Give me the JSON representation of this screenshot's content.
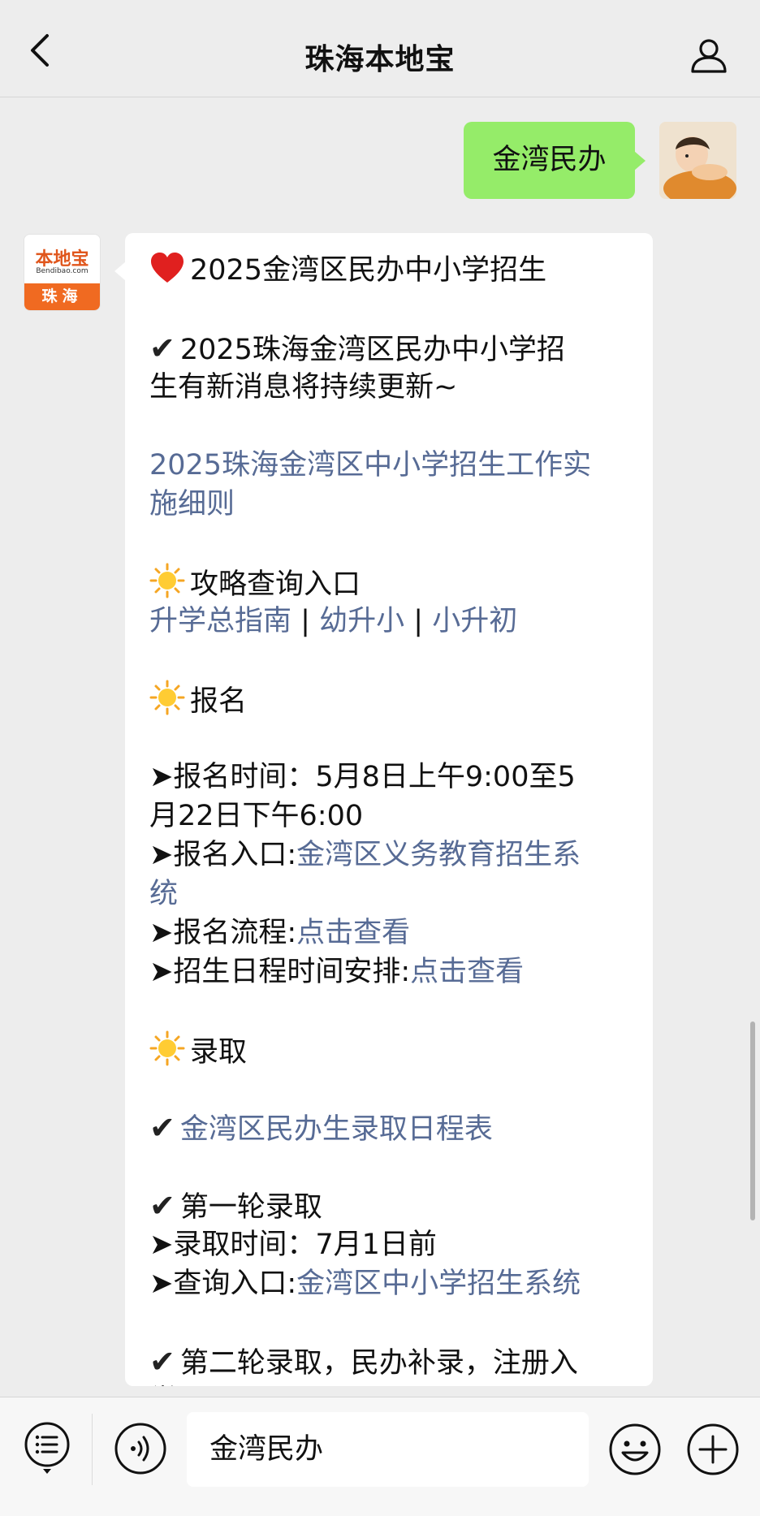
{
  "header": {
    "title": "珠海本地宝"
  },
  "outgoing": {
    "text": "金湾民办"
  },
  "bot_avatar": {
    "logo_main": "本地宝",
    "logo_sub": "Bendibao.com",
    "logo_city": "珠海"
  },
  "message": {
    "title": "2025金湾区民办中小学招生",
    "intro_1": "2025珠海金湾区民办中小学招",
    "intro_2": "生有新消息将持续更新~",
    "rules_link_1": "2025珠海金湾区中小学招生工作实",
    "rules_link_2": "施细则",
    "guide_heading": "攻略查询入口",
    "guide_links": [
      "升学总指南",
      "幼升小",
      "小升初"
    ],
    "guide_separator": "|",
    "signup_heading": "报名",
    "signup_time_1": "➤报名时间：5月8日上午9:00至5",
    "signup_time_2": "月22日下午6:00",
    "signup_entry_label": "➤报名入口:",
    "signup_entry_link_1": "金湾区义务教育招生系",
    "signup_entry_link_2": "统",
    "signup_flow_label": "➤报名流程:",
    "signup_flow_link": "点击查看",
    "schedule_label": "➤招生日程时间安排:",
    "schedule_link": "点击查看",
    "admit_heading": "录取",
    "admit_schedule_link": "金湾区民办生录取日程表",
    "round1_heading": "第一轮录取",
    "round1_time": "➤录取时间：7月1日前",
    "round1_query_label": "➤查询入口:",
    "round1_query_link": "金湾区中小学招生系统",
    "round2_heading_1": "第二轮录取，民办补录，注册入",
    "round2_heading_2": "学"
  },
  "input": {
    "value": "金湾民办"
  },
  "colors": {
    "background": "#ededed",
    "outgoing_bubble": "#95ec69",
    "link": "#576b95",
    "logo_orange": "#f06a21"
  },
  "icons": [
    "back-icon",
    "user-profile-icon",
    "heart-icon",
    "check-icon",
    "sun-icon",
    "menu-list-icon",
    "voice-icon",
    "emoji-icon",
    "plus-icon"
  ]
}
